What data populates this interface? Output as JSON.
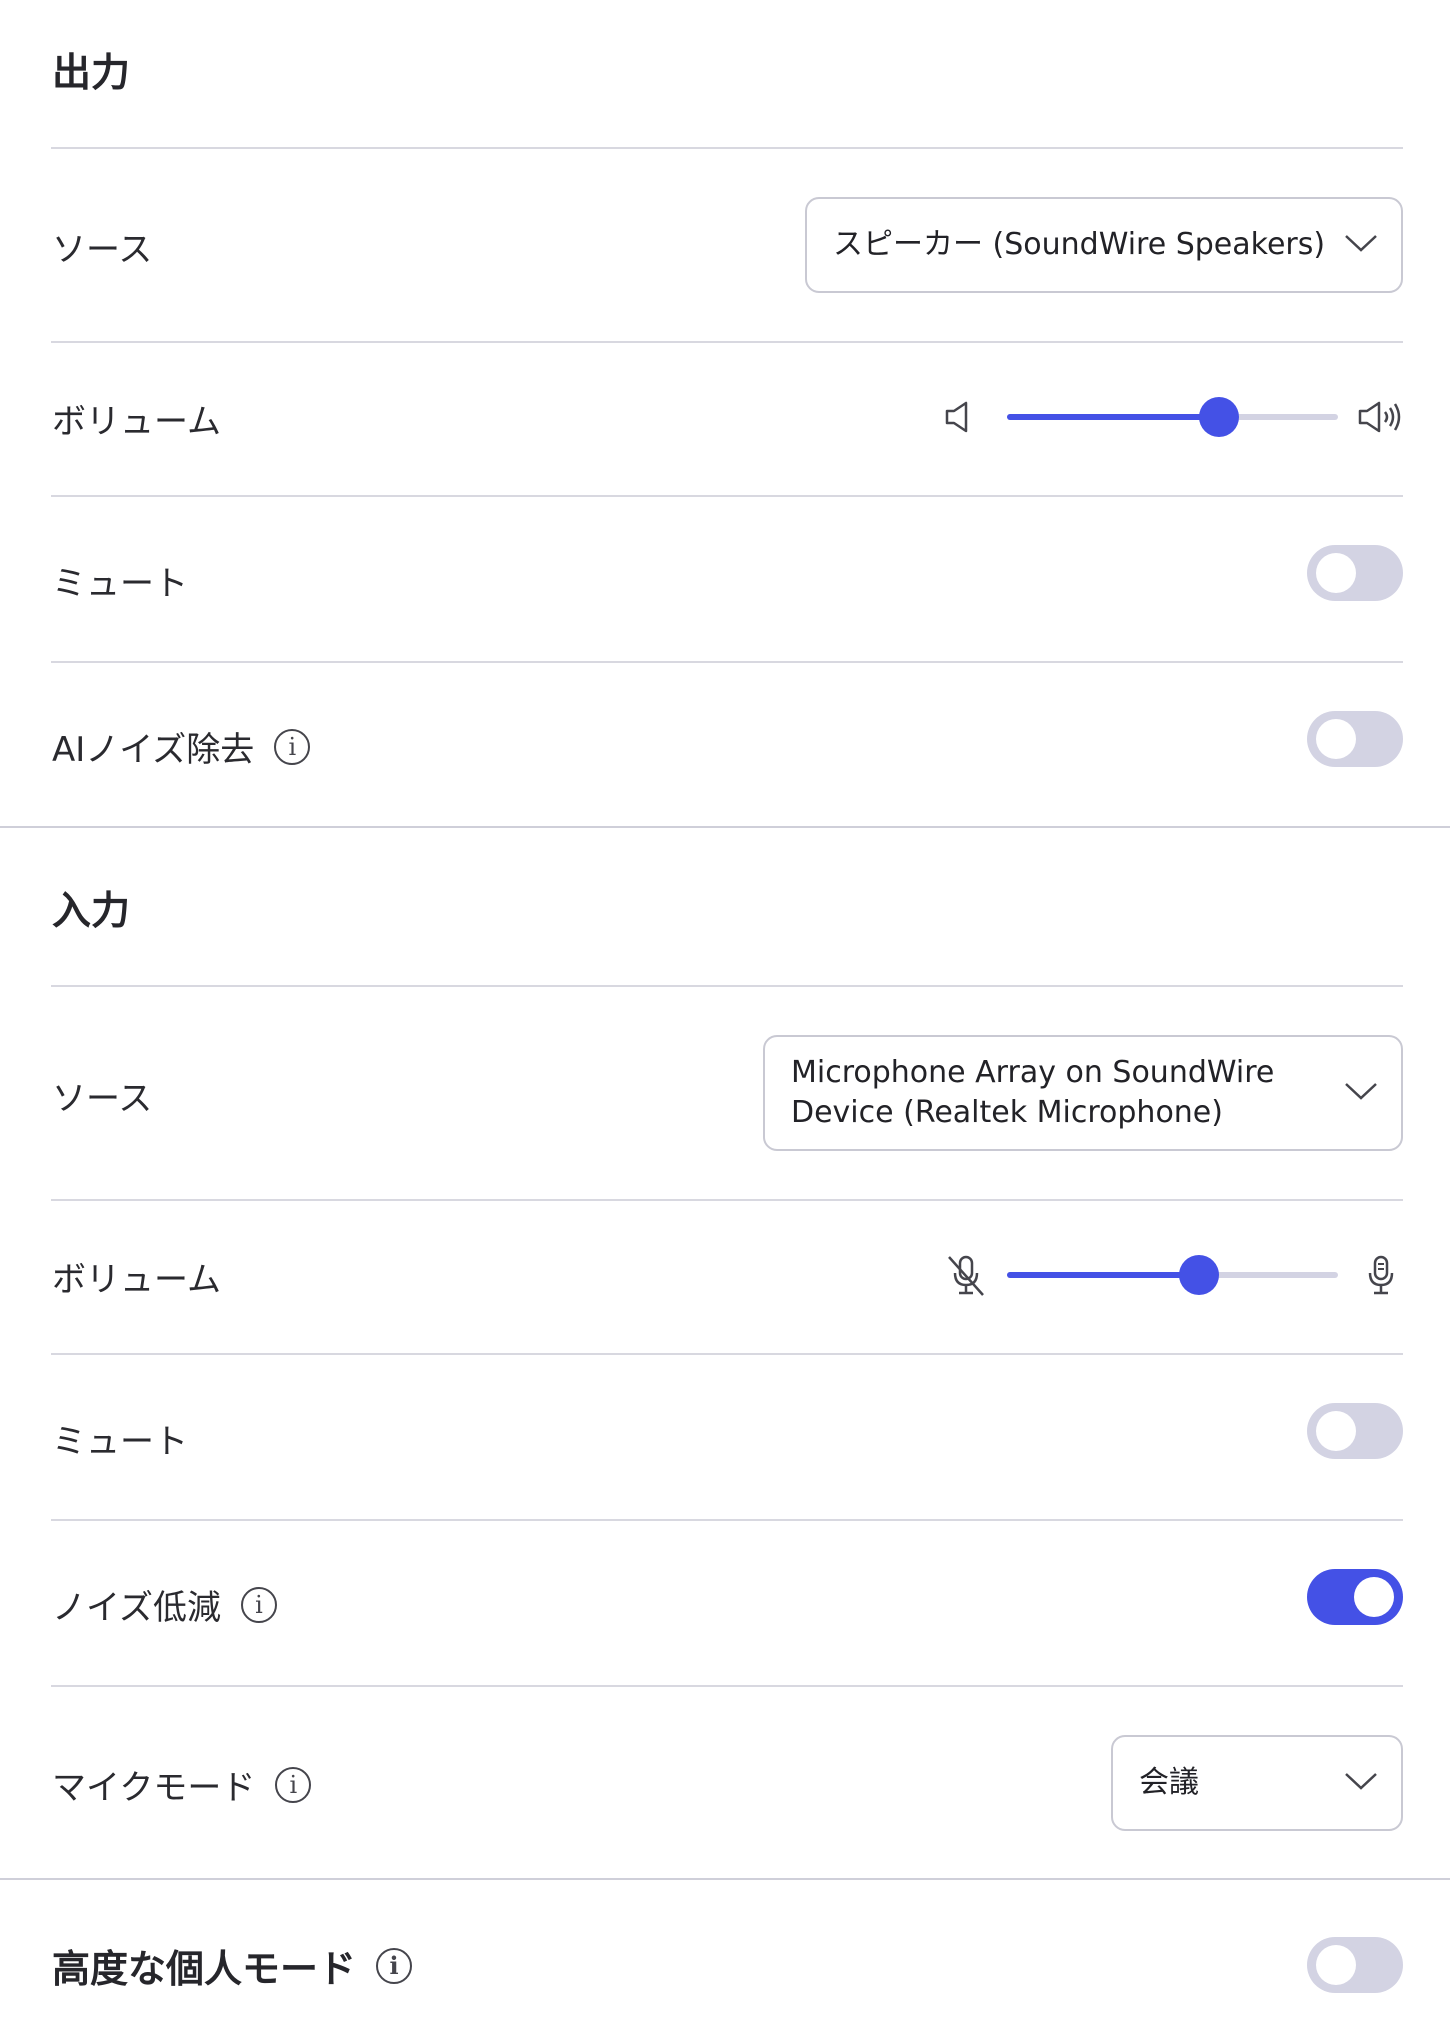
{
  "output": {
    "heading": "出力",
    "source_label": "ソース",
    "source_value": "スピーカー (SoundWire Speakers)",
    "volume_label": "ボリューム",
    "volume_level": 0.64,
    "mute_label": "ミュート",
    "mute_on": false,
    "ai_noise_label": "AIノイズ除去",
    "ai_noise_on": false
  },
  "input": {
    "heading": "入力",
    "source_label": "ソース",
    "source_value_line1": "Microphone Array on SoundWire",
    "source_value_line2": "Device (Realtek Microphone)",
    "volume_label": "ボリューム",
    "volume_level": 0.58,
    "mute_label": "ミュート",
    "mute_on": false,
    "noise_reduction_label": "ノイズ低減",
    "noise_reduction_on": true,
    "mic_mode_label": "マイクモード",
    "mic_mode_value": "会議"
  },
  "advanced": {
    "label": "高度な個人モード",
    "on": false
  },
  "info_glyph": "i",
  "colors": {
    "accent": "#4451e6",
    "toggle_off": "#d3d3e3"
  }
}
